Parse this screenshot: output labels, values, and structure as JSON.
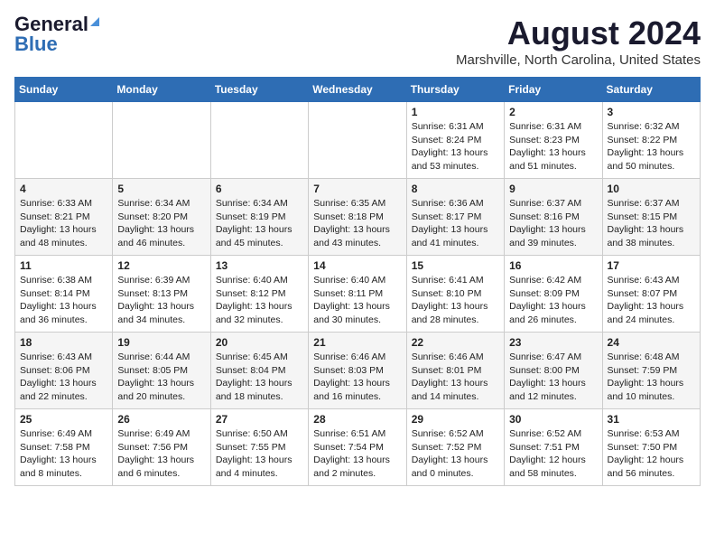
{
  "logo": {
    "line1": "General",
    "line2": "Blue"
  },
  "title": "August 2024",
  "subtitle": "Marshville, North Carolina, United States",
  "weekdays": [
    "Sunday",
    "Monday",
    "Tuesday",
    "Wednesday",
    "Thursday",
    "Friday",
    "Saturday"
  ],
  "weeks": [
    [
      {
        "day": "",
        "info": ""
      },
      {
        "day": "",
        "info": ""
      },
      {
        "day": "",
        "info": ""
      },
      {
        "day": "",
        "info": ""
      },
      {
        "day": "1",
        "info": "Sunrise: 6:31 AM\nSunset: 8:24 PM\nDaylight: 13 hours\nand 53 minutes."
      },
      {
        "day": "2",
        "info": "Sunrise: 6:31 AM\nSunset: 8:23 PM\nDaylight: 13 hours\nand 51 minutes."
      },
      {
        "day": "3",
        "info": "Sunrise: 6:32 AM\nSunset: 8:22 PM\nDaylight: 13 hours\nand 50 minutes."
      }
    ],
    [
      {
        "day": "4",
        "info": "Sunrise: 6:33 AM\nSunset: 8:21 PM\nDaylight: 13 hours\nand 48 minutes."
      },
      {
        "day": "5",
        "info": "Sunrise: 6:34 AM\nSunset: 8:20 PM\nDaylight: 13 hours\nand 46 minutes."
      },
      {
        "day": "6",
        "info": "Sunrise: 6:34 AM\nSunset: 8:19 PM\nDaylight: 13 hours\nand 45 minutes."
      },
      {
        "day": "7",
        "info": "Sunrise: 6:35 AM\nSunset: 8:18 PM\nDaylight: 13 hours\nand 43 minutes."
      },
      {
        "day": "8",
        "info": "Sunrise: 6:36 AM\nSunset: 8:17 PM\nDaylight: 13 hours\nand 41 minutes."
      },
      {
        "day": "9",
        "info": "Sunrise: 6:37 AM\nSunset: 8:16 PM\nDaylight: 13 hours\nand 39 minutes."
      },
      {
        "day": "10",
        "info": "Sunrise: 6:37 AM\nSunset: 8:15 PM\nDaylight: 13 hours\nand 38 minutes."
      }
    ],
    [
      {
        "day": "11",
        "info": "Sunrise: 6:38 AM\nSunset: 8:14 PM\nDaylight: 13 hours\nand 36 minutes."
      },
      {
        "day": "12",
        "info": "Sunrise: 6:39 AM\nSunset: 8:13 PM\nDaylight: 13 hours\nand 34 minutes."
      },
      {
        "day": "13",
        "info": "Sunrise: 6:40 AM\nSunset: 8:12 PM\nDaylight: 13 hours\nand 32 minutes."
      },
      {
        "day": "14",
        "info": "Sunrise: 6:40 AM\nSunset: 8:11 PM\nDaylight: 13 hours\nand 30 minutes."
      },
      {
        "day": "15",
        "info": "Sunrise: 6:41 AM\nSunset: 8:10 PM\nDaylight: 13 hours\nand 28 minutes."
      },
      {
        "day": "16",
        "info": "Sunrise: 6:42 AM\nSunset: 8:09 PM\nDaylight: 13 hours\nand 26 minutes."
      },
      {
        "day": "17",
        "info": "Sunrise: 6:43 AM\nSunset: 8:07 PM\nDaylight: 13 hours\nand 24 minutes."
      }
    ],
    [
      {
        "day": "18",
        "info": "Sunrise: 6:43 AM\nSunset: 8:06 PM\nDaylight: 13 hours\nand 22 minutes."
      },
      {
        "day": "19",
        "info": "Sunrise: 6:44 AM\nSunset: 8:05 PM\nDaylight: 13 hours\nand 20 minutes."
      },
      {
        "day": "20",
        "info": "Sunrise: 6:45 AM\nSunset: 8:04 PM\nDaylight: 13 hours\nand 18 minutes."
      },
      {
        "day": "21",
        "info": "Sunrise: 6:46 AM\nSunset: 8:03 PM\nDaylight: 13 hours\nand 16 minutes."
      },
      {
        "day": "22",
        "info": "Sunrise: 6:46 AM\nSunset: 8:01 PM\nDaylight: 13 hours\nand 14 minutes."
      },
      {
        "day": "23",
        "info": "Sunrise: 6:47 AM\nSunset: 8:00 PM\nDaylight: 13 hours\nand 12 minutes."
      },
      {
        "day": "24",
        "info": "Sunrise: 6:48 AM\nSunset: 7:59 PM\nDaylight: 13 hours\nand 10 minutes."
      }
    ],
    [
      {
        "day": "25",
        "info": "Sunrise: 6:49 AM\nSunset: 7:58 PM\nDaylight: 13 hours\nand 8 minutes."
      },
      {
        "day": "26",
        "info": "Sunrise: 6:49 AM\nSunset: 7:56 PM\nDaylight: 13 hours\nand 6 minutes."
      },
      {
        "day": "27",
        "info": "Sunrise: 6:50 AM\nSunset: 7:55 PM\nDaylight: 13 hours\nand 4 minutes."
      },
      {
        "day": "28",
        "info": "Sunrise: 6:51 AM\nSunset: 7:54 PM\nDaylight: 13 hours\nand 2 minutes."
      },
      {
        "day": "29",
        "info": "Sunrise: 6:52 AM\nSunset: 7:52 PM\nDaylight: 13 hours\nand 0 minutes."
      },
      {
        "day": "30",
        "info": "Sunrise: 6:52 AM\nSunset: 7:51 PM\nDaylight: 12 hours\nand 58 minutes."
      },
      {
        "day": "31",
        "info": "Sunrise: 6:53 AM\nSunset: 7:50 PM\nDaylight: 12 hours\nand 56 minutes."
      }
    ]
  ]
}
